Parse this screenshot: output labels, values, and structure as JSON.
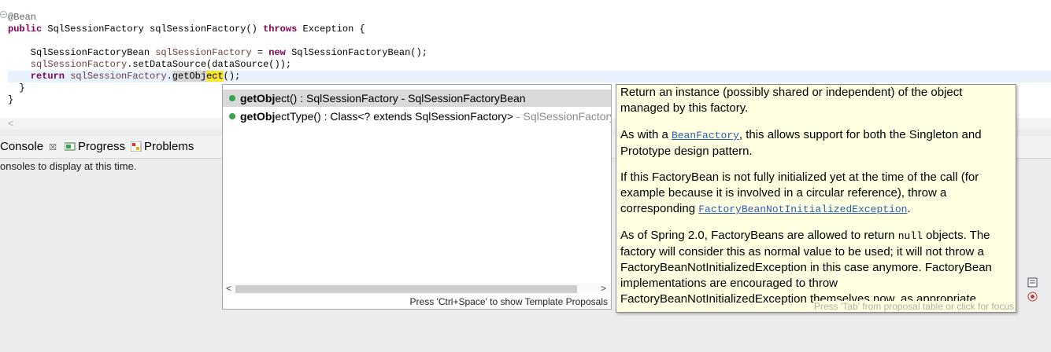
{
  "editor": {
    "lines": {
      "l1_annotation": "@Bean",
      "l2_kw_public": "public",
      "l2_rest_a": " SqlSessionFactory sqlSessionFactory() ",
      "l2_kw_throws": "throws",
      "l2_rest_b": " Exception {",
      "l4_type": "    SqlSessionFactoryBean ",
      "l4_field": "sqlSessionFactory",
      "l4_eq": " = ",
      "l4_kw_new": "new",
      "l4_rest": " SqlSessionFactoryBean();",
      "l5_field": "    sqlSessionFactory",
      "l5_rest": ".setDataSource(dataSource());",
      "l6_kw_return": "    return",
      "l6_sp": " ",
      "l6_field": "sqlSessionFactory",
      "l6_dot": ".",
      "l6_typed": "getObj",
      "l6_completion": "ect",
      "l6_end": "();",
      "l7": "  }",
      "l8": "}"
    }
  },
  "views": {
    "console_tab": "Console",
    "console_close": "☒",
    "progress_tab": "Progress",
    "problems_tab": "Problems",
    "console_message": "onsoles to display at this time."
  },
  "proposals": {
    "items": [
      {
        "bold": "getObj",
        "rest": "ect() : SqlSessionFactory - SqlSessionFactoryBean",
        "qual": ""
      },
      {
        "bold": "getObj",
        "rest": "ectType() : Class<? extends SqlSessionFactory>",
        "qual": " - SqlSessionFactoryB"
      }
    ],
    "status": "Press 'Ctrl+Space' to show Template Proposals",
    "scroll_left": "<",
    "scroll_right": ">"
  },
  "javadoc": {
    "p1": "Return an instance (possibly shared or independent) of the object managed by this factory.",
    "p2_a": "As with a ",
    "p2_link": "BeanFactory",
    "p2_b": ", this allows support for both the Singleton and Prototype design pattern.",
    "p3_a": "If this FactoryBean is not fully initialized yet at the time of the call (for example because it is involved in a circular reference), throw a corresponding ",
    "p3_link": "FactoryBeanNotInitializedException",
    "p3_b": ".",
    "p4_a": "As of Spring 2.0, FactoryBeans are allowed to return ",
    "p4_code": "null",
    "p4_b": " objects. The factory will consider this as normal value to be used; it will not throw a FactoryBeanNotInitializedException in this case anymore. FactoryBean implementations are encouraged to throw FactoryBeanNotInitializedException themselves now, as appropriate.",
    "status": "Press 'Tab' from proposal table or click for focus"
  },
  "colors": {
    "keyword": "#7f0055",
    "field": "#6a3e3e",
    "current_line": "#e8f2fe",
    "hover_bg": "#ffffe1",
    "link": "#2a5db0"
  }
}
